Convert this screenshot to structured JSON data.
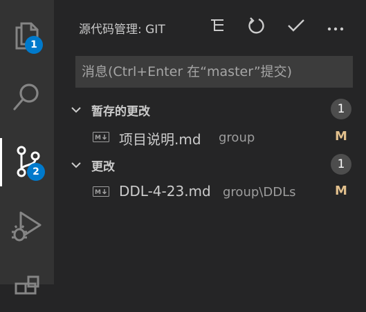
{
  "activity_bar": {
    "items": [
      {
        "icon": "files-icon",
        "badge": "1"
      },
      {
        "icon": "search-icon"
      },
      {
        "icon": "source-control-icon",
        "badge": "2"
      },
      {
        "icon": "run-debug-icon"
      },
      {
        "icon": "extensions-icon"
      }
    ],
    "badge_color": "#007acc"
  },
  "scm": {
    "title": "源代码管理: GIT",
    "actions": [
      "view-as-tree-icon",
      "refresh-icon",
      "commit-check-icon",
      "more-actions-icon"
    ],
    "commit_placeholder": "消息(Ctrl+Enter 在“master”提交)",
    "staged": {
      "label": "暂存的更改",
      "count": "1",
      "files": [
        {
          "name": "项目说明.md",
          "path": "group",
          "status": "M"
        }
      ]
    },
    "changes": {
      "label": "更改",
      "count": "1",
      "files": [
        {
          "name": "DDL-4-23.md",
          "path": "group\\DDLs",
          "status": "M"
        }
      ]
    }
  },
  "colors": {
    "activity_bar": "#333333",
    "sidebar": "#252526",
    "input": "#3c3c3c",
    "modified": "#e2c08d"
  }
}
